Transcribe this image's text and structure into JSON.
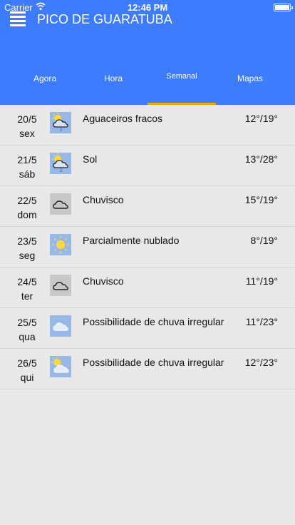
{
  "status": {
    "carrier": "Carrier",
    "time": "12:46 PM"
  },
  "header": {
    "title": "PICO DE GUARATUBA"
  },
  "tabs": [
    {
      "label": "Agora"
    },
    {
      "label": "Hora"
    },
    {
      "label": "Semanal"
    },
    {
      "label": "Mapas"
    }
  ],
  "colors": {
    "header": "#3d7bff",
    "tab_indicator": "#ffa500",
    "background": "#e8e8e8"
  },
  "forecast": [
    {
      "date": "20/5",
      "day": "sex",
      "icon": "sun-cloud-rain-icon",
      "desc": "Aguaceiros fracos",
      "temp": "12°/19°"
    },
    {
      "date": "21/5",
      "day": "sáb",
      "icon": "sun-cloud-rain-icon",
      "desc": "Sol",
      "temp": "13°/28°"
    },
    {
      "date": "22/5",
      "day": "dom",
      "icon": "cloud-icon",
      "desc": "Chuvisco",
      "temp": "15°/19°"
    },
    {
      "date": "23/5",
      "day": "seg",
      "icon": "sun-icon",
      "desc": "Parcialmente nublado",
      "temp": "8°/19°"
    },
    {
      "date": "24/5",
      "day": "ter",
      "icon": "cloud-icon",
      "desc": "Chuvisco",
      "temp": "11°/19°"
    },
    {
      "date": "25/5",
      "day": "qua",
      "icon": "cloud-light-icon",
      "desc": "Possibilidade de chuva irregular",
      "temp": "11°/23°"
    },
    {
      "date": "26/5",
      "day": "qui",
      "icon": "sun-cloud-icon",
      "desc": "Possibilidade de chuva irregular",
      "temp": "12°/23°"
    }
  ]
}
